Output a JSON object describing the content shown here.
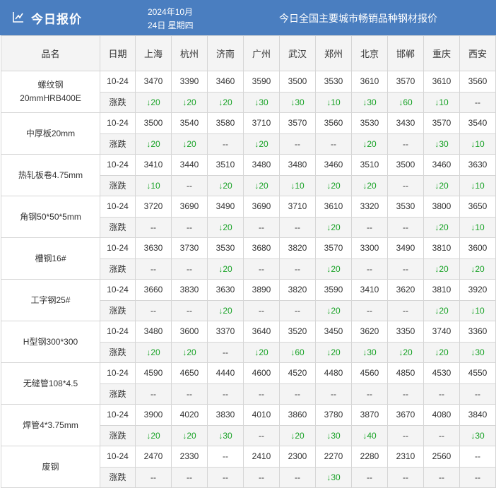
{
  "header": {
    "title": "今日报价",
    "date_line1": "2024年10月",
    "date_line2": "24日 星期四",
    "subtitle": "今日全国主要城市畅销品种钢材报价",
    "accent_color": "#4a7ec0",
    "icon": "line-chart-icon"
  },
  "columns": {
    "product": "品名",
    "date": "日期",
    "cities": [
      "上海",
      "杭州",
      "济南",
      "广州",
      "武汉",
      "郑州",
      "北京",
      "邯郸",
      "重庆",
      "西安"
    ]
  },
  "change_label": "涨跌",
  "down_color": "#1aa328",
  "products": [
    {
      "name": "螺纹钢\n20mmHRB400E",
      "date": "10-24",
      "prices": [
        "3470",
        "3390",
        "3460",
        "3590",
        "3500",
        "3530",
        "3610",
        "3570",
        "3610",
        "3560"
      ],
      "changes": [
        "↓20",
        "↓20",
        "↓20",
        "↓30",
        "↓30",
        "↓10",
        "↓30",
        "↓60",
        "↓10",
        "--"
      ]
    },
    {
      "name": "中厚板20mm",
      "date": "10-24",
      "prices": [
        "3500",
        "3540",
        "3580",
        "3710",
        "3570",
        "3560",
        "3530",
        "3430",
        "3570",
        "3540"
      ],
      "changes": [
        "↓20",
        "↓20",
        "--",
        "↓20",
        "--",
        "--",
        "↓20",
        "--",
        "↓30",
        "↓10"
      ]
    },
    {
      "name": "热轧板卷4.75mm",
      "date": "10-24",
      "prices": [
        "3410",
        "3440",
        "3510",
        "3480",
        "3480",
        "3460",
        "3510",
        "3500",
        "3460",
        "3630"
      ],
      "changes": [
        "↓10",
        "--",
        "↓20",
        "↓20",
        "↓10",
        "↓20",
        "↓20",
        "--",
        "↓20",
        "↓10"
      ]
    },
    {
      "name": "角钢50*50*5mm",
      "date": "10-24",
      "prices": [
        "3720",
        "3690",
        "3490",
        "3690",
        "3710",
        "3610",
        "3320",
        "3530",
        "3800",
        "3650"
      ],
      "changes": [
        "--",
        "--",
        "↓20",
        "--",
        "--",
        "↓20",
        "--",
        "--",
        "↓20",
        "↓10"
      ]
    },
    {
      "name": "槽钢16#",
      "date": "10-24",
      "prices": [
        "3630",
        "3730",
        "3530",
        "3680",
        "3820",
        "3570",
        "3300",
        "3490",
        "3810",
        "3600"
      ],
      "changes": [
        "--",
        "--",
        "↓20",
        "--",
        "--",
        "↓20",
        "--",
        "--",
        "↓20",
        "↓20"
      ]
    },
    {
      "name": "工字钢25#",
      "date": "10-24",
      "prices": [
        "3660",
        "3830",
        "3630",
        "3890",
        "3820",
        "3590",
        "3410",
        "3620",
        "3810",
        "3920"
      ],
      "changes": [
        "--",
        "--",
        "↓20",
        "--",
        "--",
        "↓20",
        "--",
        "--",
        "↓20",
        "↓10"
      ]
    },
    {
      "name": "H型钢300*300",
      "date": "10-24",
      "prices": [
        "3480",
        "3600",
        "3370",
        "3640",
        "3520",
        "3450",
        "3620",
        "3350",
        "3740",
        "3360"
      ],
      "changes": [
        "↓20",
        "↓20",
        "--",
        "↓20",
        "↓60",
        "↓20",
        "↓30",
        "↓20",
        "↓20",
        "↓30"
      ]
    },
    {
      "name": "无缝管108*4.5",
      "date": "10-24",
      "prices": [
        "4590",
        "4650",
        "4440",
        "4600",
        "4520",
        "4480",
        "4560",
        "4850",
        "4530",
        "4550"
      ],
      "changes": [
        "--",
        "--",
        "--",
        "--",
        "--",
        "--",
        "--",
        "--",
        "--",
        "--"
      ]
    },
    {
      "name": "焊管4*3.75mm",
      "date": "10-24",
      "prices": [
        "3900",
        "4020",
        "3830",
        "4010",
        "3860",
        "3780",
        "3870",
        "3670",
        "4080",
        "3840"
      ],
      "changes": [
        "↓20",
        "↓20",
        "↓30",
        "--",
        "↓20",
        "↓30",
        "↓40",
        "--",
        "--",
        "↓30"
      ]
    },
    {
      "name": "废钢",
      "date": "10-24",
      "prices": [
        "2470",
        "2330",
        "--",
        "2410",
        "2300",
        "2270",
        "2280",
        "2310",
        "2560",
        "--"
      ],
      "changes": [
        "--",
        "--",
        "--",
        "--",
        "--",
        "↓30",
        "--",
        "--",
        "--",
        "--"
      ]
    }
  ]
}
